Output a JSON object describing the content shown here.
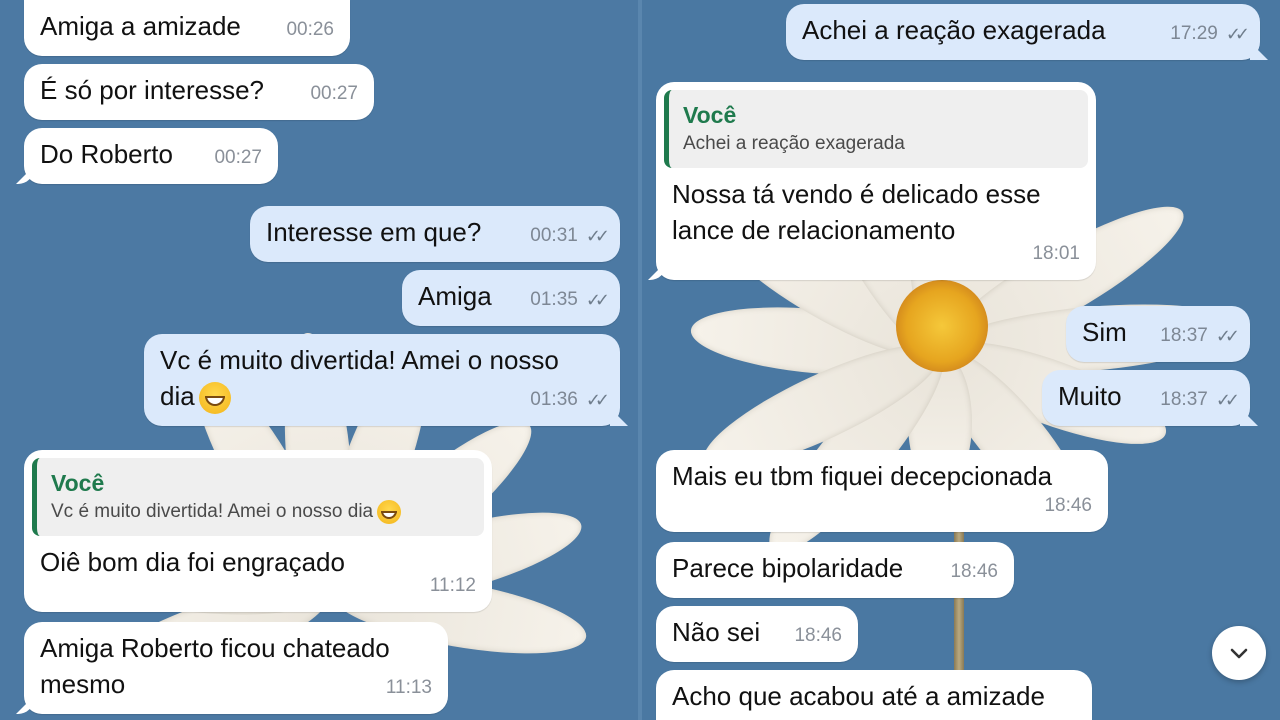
{
  "left_panel": {
    "messages": [
      {
        "text": "Amiga a amizade",
        "time": "00:26",
        "dir": "in"
      },
      {
        "text": "É só por interesse?",
        "time": "00:27",
        "dir": "in"
      },
      {
        "text": "Do Roberto",
        "time": "00:27",
        "dir": "in"
      },
      {
        "text": "Interesse em que?",
        "time": "00:31",
        "dir": "out"
      },
      {
        "text": "Amiga",
        "time": "01:35",
        "dir": "out"
      },
      {
        "text_line1": "Vc é muito divertida! Amei o nosso",
        "text_line2": "dia",
        "time": "01:36",
        "dir": "out",
        "emoji": "grinning-face"
      },
      {
        "quote_author": "Você",
        "quote_text": "Vc é muito divertida! Amei o nosso dia",
        "text": "Oiê bom dia foi engraçado",
        "time": "11:12",
        "dir": "in"
      },
      {
        "text_line1": "Amiga Roberto ficou chateado",
        "text_line2": "mesmo",
        "time": "11:13",
        "dir": "in"
      }
    ]
  },
  "right_panel": {
    "messages": [
      {
        "text": "Achei a reação exagerada",
        "time": "17:29",
        "dir": "out"
      },
      {
        "quote_author": "Você",
        "quote_text": "Achei a reação exagerada",
        "text_line1": "Nossa tá vendo é delicado esse",
        "text_line2": "lance de relacionamento",
        "time": "18:01",
        "dir": "in"
      },
      {
        "text": "Sim",
        "time": "18:37",
        "dir": "out"
      },
      {
        "text": "Muito",
        "time": "18:37",
        "dir": "out"
      },
      {
        "text": "Mais eu tbm fiquei decepcionada",
        "time": "18:46",
        "dir": "in"
      },
      {
        "text": "Parece bipolaridade",
        "time": "18:46",
        "dir": "in"
      },
      {
        "text": "Não sei",
        "time": "18:46",
        "dir": "in"
      },
      {
        "text": "Acho que acabou até a amizade",
        "dir": "in"
      }
    ]
  },
  "scroll_button_icon": "chevron-down-icon",
  "read_receipt_icon": "double-check-icon",
  "colors": {
    "background": "#4a78a2",
    "incoming_bubble": "#ffffff",
    "outgoing_bubble": "#dbe9fb",
    "quote_accent": "#1f7a4d"
  }
}
